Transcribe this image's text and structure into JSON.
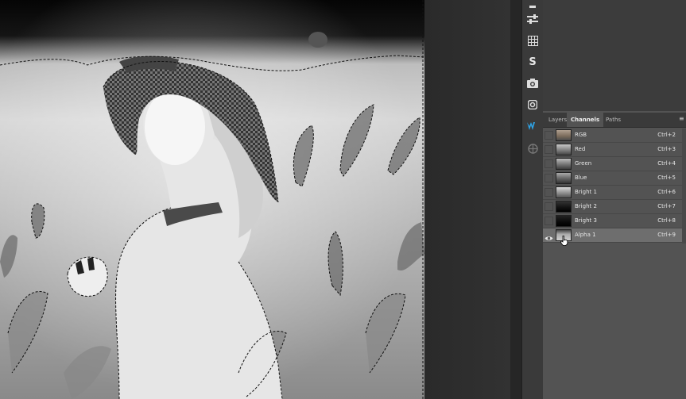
{
  "panel": {
    "tabs": [
      {
        "label": "Layers"
      },
      {
        "label": "Channels"
      },
      {
        "label": "Paths"
      }
    ],
    "channels": [
      {
        "name": "RGB",
        "shortcut": "Ctrl+2",
        "visible": false,
        "selected": false
      },
      {
        "name": "Red",
        "shortcut": "Ctrl+3",
        "visible": false,
        "selected": false
      },
      {
        "name": "Green",
        "shortcut": "Ctrl+4",
        "visible": false,
        "selected": false
      },
      {
        "name": "Blue",
        "shortcut": "Ctrl+5",
        "visible": false,
        "selected": false
      },
      {
        "name": "Bright 1",
        "shortcut": "Ctrl+6",
        "visible": false,
        "selected": false
      },
      {
        "name": "Bright 2",
        "shortcut": "Ctrl+7",
        "visible": false,
        "selected": false
      },
      {
        "name": "Bright 3",
        "shortcut": "Ctrl+8",
        "visible": false,
        "selected": false
      },
      {
        "name": "Alpha 1",
        "shortcut": "Ctrl+9",
        "visible": true,
        "selected": true
      }
    ]
  },
  "toolbar": {
    "icons": [
      "history-icon",
      "adjustments-icon",
      "grid-icon",
      "s-plugin-icon",
      "camera-icon",
      "instagram-icon",
      "w-plugin-icon",
      "extension-icon"
    ],
    "s_glyph": "S"
  }
}
